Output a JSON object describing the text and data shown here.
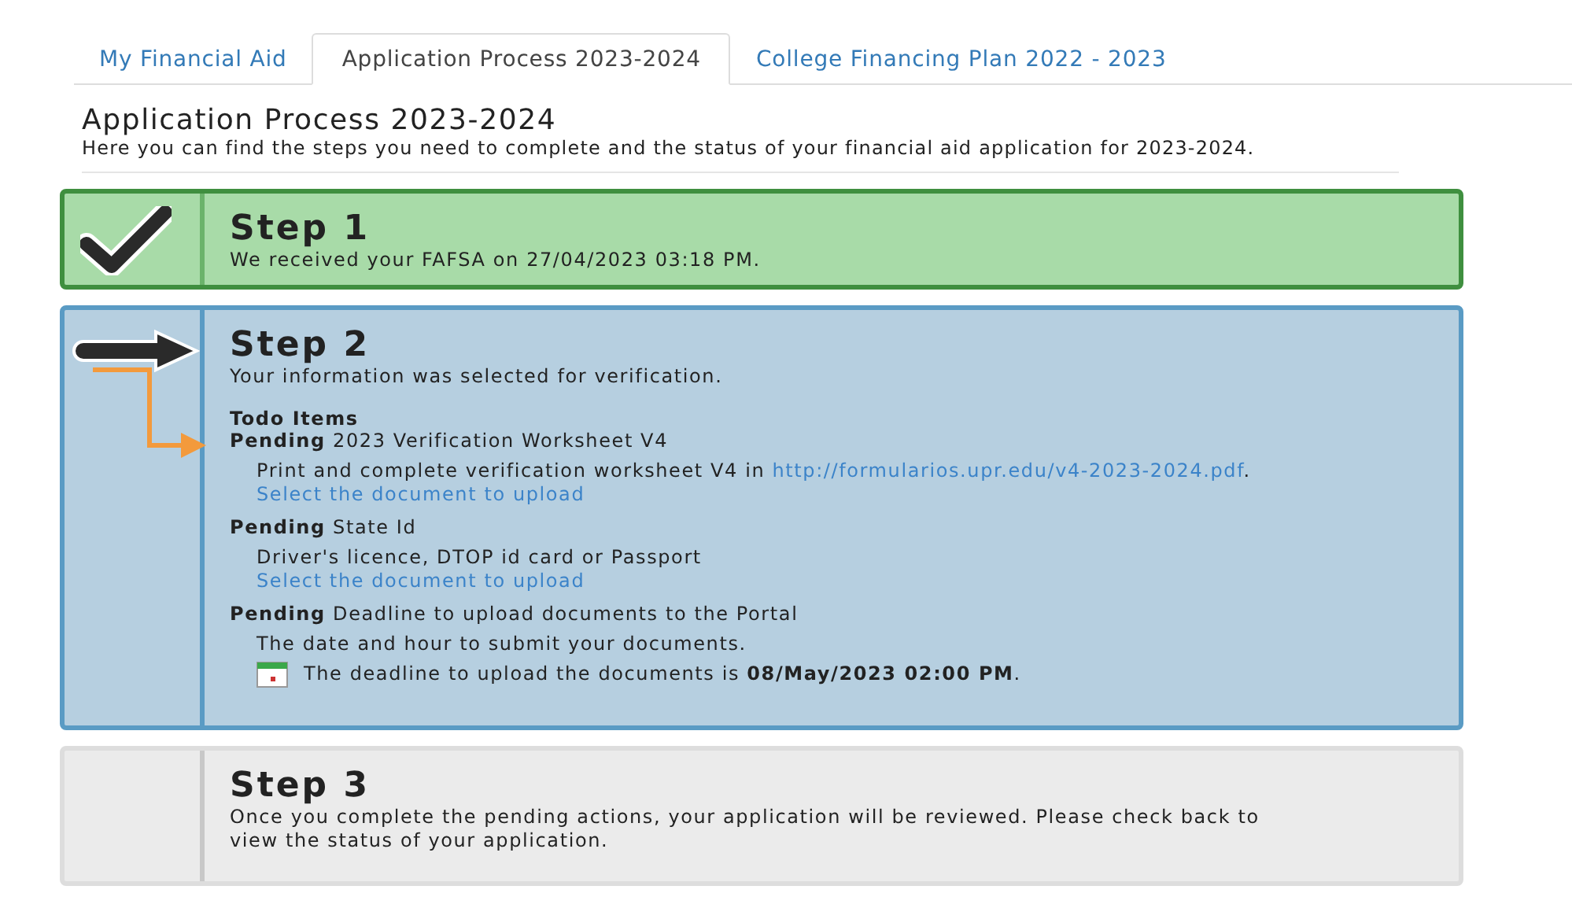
{
  "tabs": [
    {
      "label": "My Financial Aid",
      "selected": false
    },
    {
      "label": "Application Process 2023-2024",
      "selected": true
    },
    {
      "label": "College Financing Plan 2022 - 2023",
      "selected": false
    }
  ],
  "page": {
    "title": "Application Process 2023-2024",
    "description": "Here you can find the steps you need to complete and the status of your financial aid application for 2023-2024."
  },
  "steps": [
    {
      "kind": "done",
      "title": "Step 1",
      "text": "We received your FAFSA on 27/04/2023 03:18 PM."
    },
    {
      "kind": "current",
      "title": "Step 2",
      "text": "Your information was selected for verification.",
      "todo_heading": "Todo Items",
      "todo": [
        {
          "status": "Pending",
          "title": "2023 Verification Worksheet V4",
          "detail": "Print and complete verification worksheet V4 in",
          "link": "http://formularios.upr.edu/v4-2023-2024.pdf",
          "detail_end": ".",
          "action": "Select the document to upload"
        },
        {
          "status": "Pending",
          "title": "State Id",
          "detail": "Driver's licence, DTOP id card or Passport",
          "action": "Select the document to upload"
        },
        {
          "status": "Pending",
          "title": "Deadline to upload documents to the Portal",
          "detail": "The date and hour to submit your documents.",
          "deadline": "The deadline to upload the documents is **08/May/2023 02:00 PM**."
        }
      ]
    },
    {
      "kind": "pending",
      "title": "Step 3",
      "text": "Once you complete the pending actions, your application will be reviewed. Please check back to view the status of your application."
    }
  ]
}
